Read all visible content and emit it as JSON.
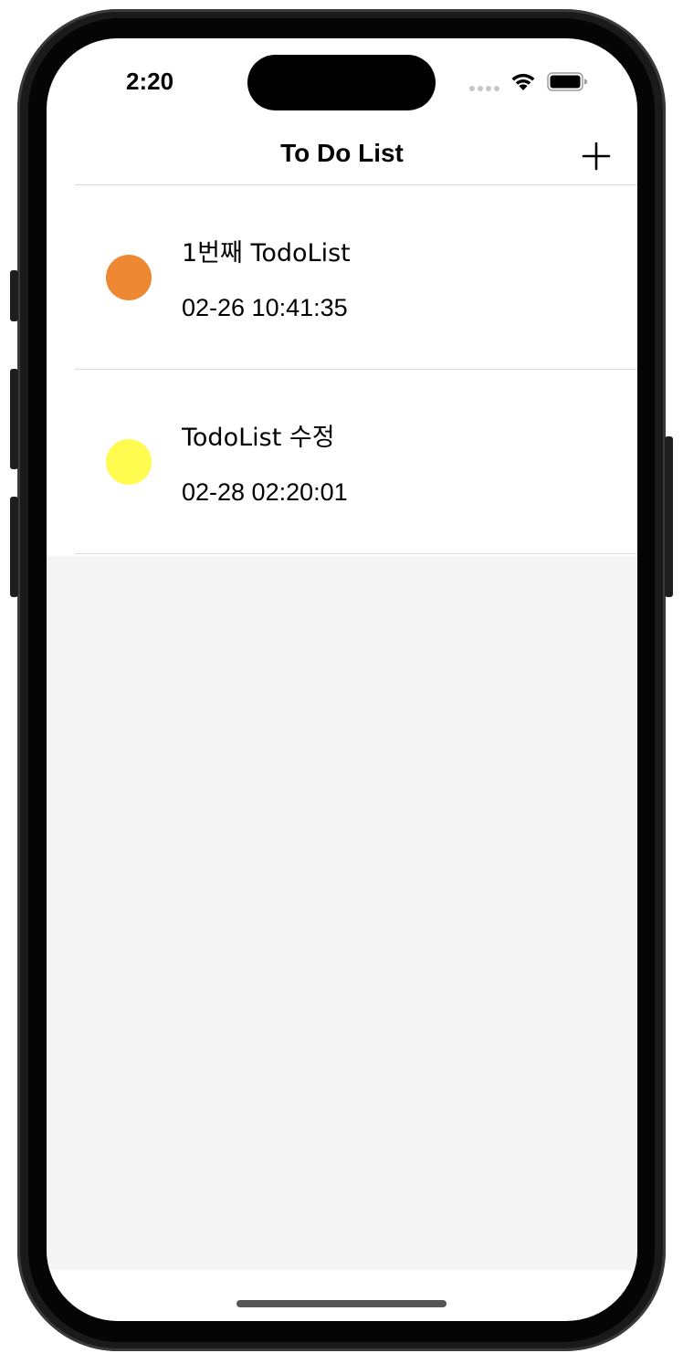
{
  "status_bar": {
    "time": "2:20",
    "wifi_icon": "wifi-icon",
    "battery_icon": "battery-icon",
    "signal_icon": "cellular-signal-icon"
  },
  "nav": {
    "title": "To Do List",
    "add_icon": "plus-icon"
  },
  "todos": [
    {
      "title": "1번째 TodoList",
      "date": "02-26 10:41:35",
      "color": "#EE8833"
    },
    {
      "title": "TodoList 수정",
      "date": "02-28 02:20:01",
      "color": "#FFFB4F"
    }
  ],
  "colors": {
    "empty_background": "#F4F4F4",
    "divider": "#DCDCDC"
  }
}
